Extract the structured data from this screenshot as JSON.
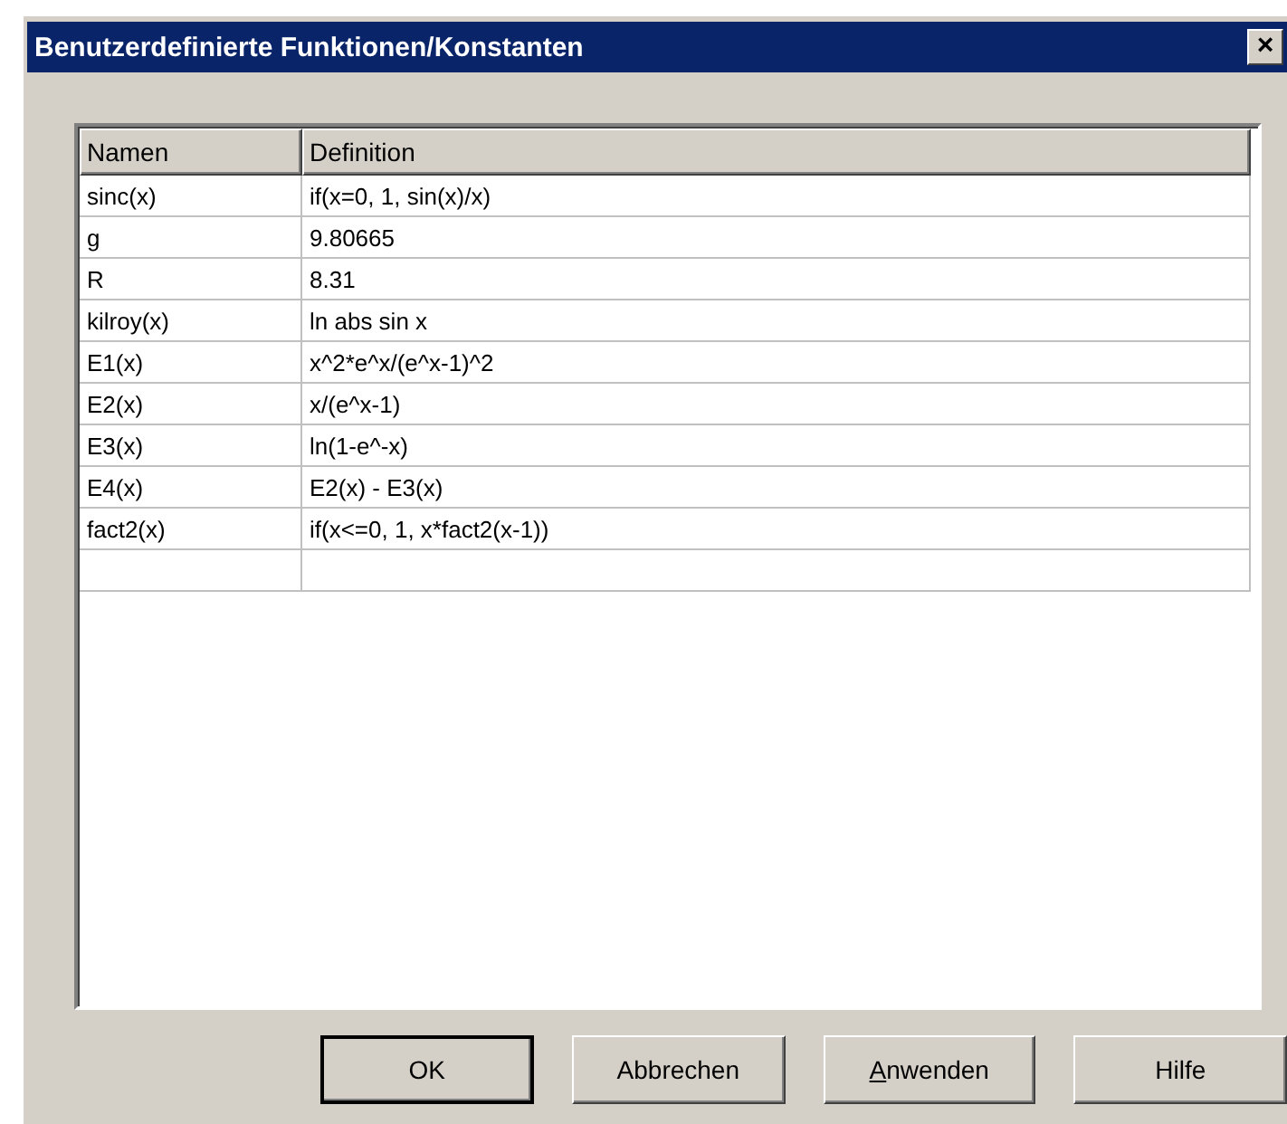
{
  "window": {
    "title": "Benutzerdefinierte Funktionen/Konstanten",
    "close": "×"
  },
  "table": {
    "columns": [
      "Namen",
      "Definition"
    ],
    "rows": [
      {
        "name": "sinc(x)",
        "definition": "if(x=0, 1, sin(x)/x)"
      },
      {
        "name": "g",
        "definition": "9.80665"
      },
      {
        "name": "R",
        "definition": "8.31"
      },
      {
        "name": "kilroy(x)",
        "definition": "ln abs sin x"
      },
      {
        "name": "E1(x)",
        "definition": "x^2*e^x/(e^x-1)^2"
      },
      {
        "name": "E2(x)",
        "definition": "x/(e^x-1)"
      },
      {
        "name": "E3(x)",
        "definition": "ln(1-e^-x)"
      },
      {
        "name": "E4(x)",
        "definition": "E2(x) - E3(x)"
      },
      {
        "name": "fact2(x)",
        "definition": "if(x<=0, 1, x*fact2(x-1))"
      },
      {
        "name": "",
        "definition": ""
      }
    ]
  },
  "buttons": [
    {
      "label": "OK",
      "default": true
    },
    {
      "label": "Abbrechen",
      "default": false
    },
    {
      "label": "Anwenden",
      "default": false,
      "mnemonic": true
    },
    {
      "label": "Hilfe",
      "default": false
    }
  ]
}
